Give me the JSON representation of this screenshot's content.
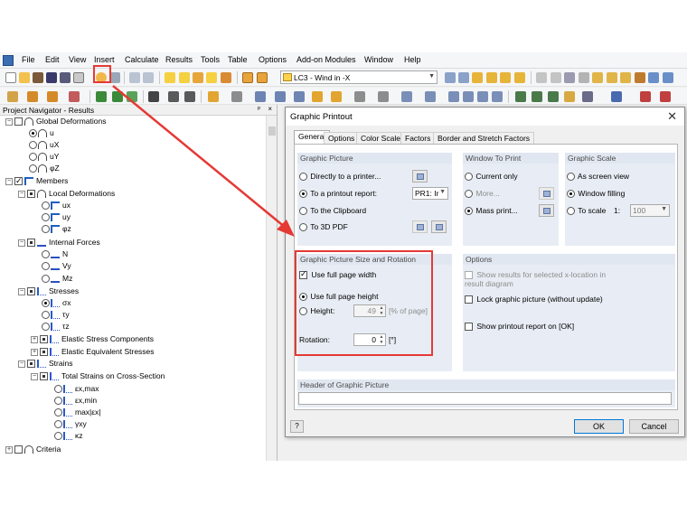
{
  "menubar": {
    "items": [
      "File",
      "Edit",
      "View",
      "Insert",
      "Calculate",
      "Results",
      "Tools",
      "Table",
      "Options",
      "Add-on Modules",
      "Window",
      "Help"
    ]
  },
  "toolbar": {
    "loadcase_value": "LC3 - Wind in -X"
  },
  "navigator": {
    "title": "Project Navigator - Results",
    "pin": "p",
    "close": "×",
    "tree": [
      {
        "label": "Global Deformations"
      },
      {
        "label": "u"
      },
      {
        "label": "uX"
      },
      {
        "label": "uY"
      },
      {
        "label": "φZ"
      },
      {
        "label": "Members"
      },
      {
        "label": "Local Deformations"
      },
      {
        "label": "ux"
      },
      {
        "label": "uy"
      },
      {
        "label": "φz"
      },
      {
        "label": "Internal Forces"
      },
      {
        "label": "N"
      },
      {
        "label": "Vy"
      },
      {
        "label": "Mz"
      },
      {
        "label": "Stresses"
      },
      {
        "label": "σx"
      },
      {
        "label": "τy"
      },
      {
        "label": "τz"
      },
      {
        "label": "Elastic Stress Components"
      },
      {
        "label": "Elastic Equivalent Stresses"
      },
      {
        "label": "Strains"
      },
      {
        "label": "Total Strains on Cross-Section"
      },
      {
        "label": "εx,max"
      },
      {
        "label": "εx,min"
      },
      {
        "label": "max|εx|"
      },
      {
        "label": "γxy"
      },
      {
        "label": "κz"
      },
      {
        "label": "Criteria"
      }
    ]
  },
  "dialog": {
    "title": "Graphic Printout",
    "close": "✕",
    "tabs": [
      "General",
      "Options",
      "Color Scale",
      "Factors",
      "Border and Stretch Factors"
    ],
    "graphic_picture": {
      "title": "Graphic Picture",
      "opt_printer": "Directly to a printer...",
      "opt_report": "To a printout report:",
      "report_value": "PR1: Ir",
      "opt_clipboard": "To the Clipboard",
      "opt_pdf": "To 3D PDF"
    },
    "window_to_print": {
      "title": "Window To Print",
      "opt_current": "Current only",
      "opt_more": "More...",
      "opt_mass": "Mass print..."
    },
    "graphic_scale": {
      "title": "Graphic Scale",
      "opt_screen": "As screen view",
      "opt_filling": "Window filling",
      "opt_scale": "To scale",
      "scale_prefix": "1:",
      "scale_value": "100"
    },
    "size_rotation": {
      "title": "Graphic Picture Size and Rotation",
      "full_width": "Use full page width",
      "full_height": "Use full page height",
      "height_label": "Height:",
      "height_value": "49",
      "height_unit": "[% of page]",
      "rotation_label": "Rotation:",
      "rotation_value": "0",
      "rotation_unit": "[°]"
    },
    "options": {
      "title": "Options",
      "show_results": "Show results for selected x-location in result diagram",
      "lock_picture": "Lock graphic picture (without update)",
      "show_report": "Show printout report on [OK]"
    },
    "header": {
      "title": "Header of Graphic Picture",
      "value": ""
    },
    "help": "?",
    "ok": "OK",
    "cancel": "Cancel"
  },
  "colors": {
    "annotation_red": "#e53935",
    "group_bg": "#e8edf5",
    "group_header": "#e1e7f1"
  }
}
